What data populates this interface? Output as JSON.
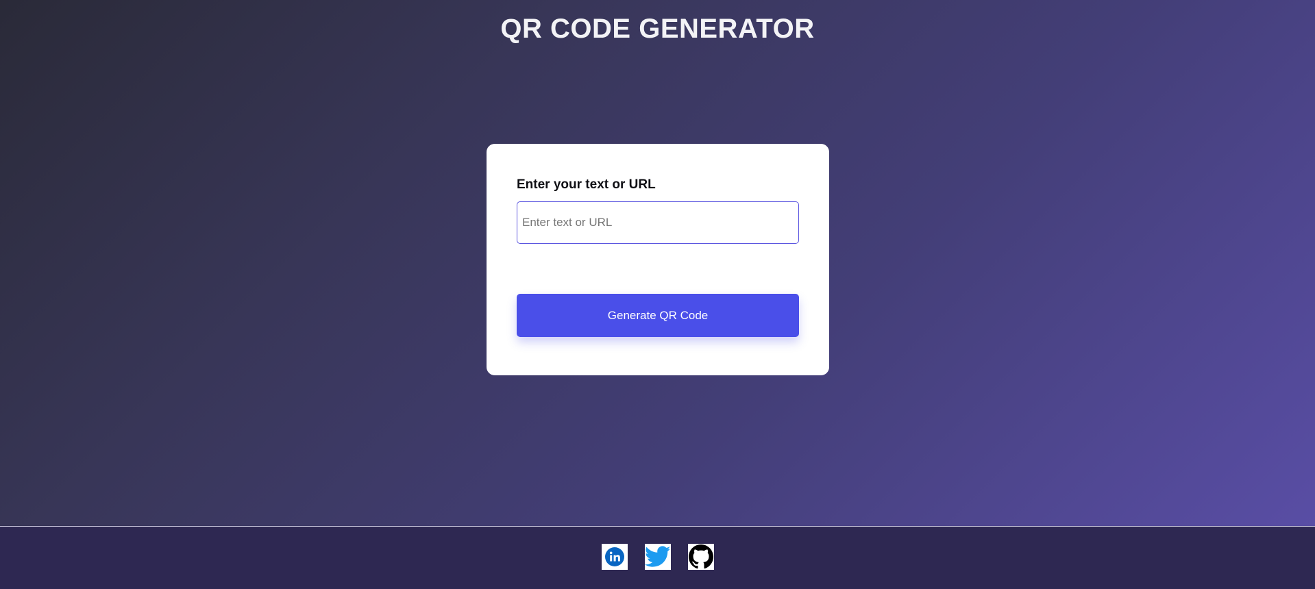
{
  "header": {
    "title": "QR CODE GENERATOR"
  },
  "form": {
    "label": "Enter your text or URL",
    "input_value": "",
    "input_placeholder": "Enter text or URL",
    "generate_label": "Generate QR Code"
  },
  "footer": {
    "social": [
      {
        "name": "linkedin",
        "icon": "linkedin-icon",
        "color": "#0a66c2"
      },
      {
        "name": "twitter",
        "icon": "twitter-icon",
        "color": "#1d9bf0"
      },
      {
        "name": "github",
        "icon": "github-icon",
        "color": "#000000"
      }
    ]
  },
  "colors": {
    "accent": "#4a4fe9",
    "card": "#ffffff",
    "footer": "#2e2852",
    "title": "#f3f3f6"
  }
}
